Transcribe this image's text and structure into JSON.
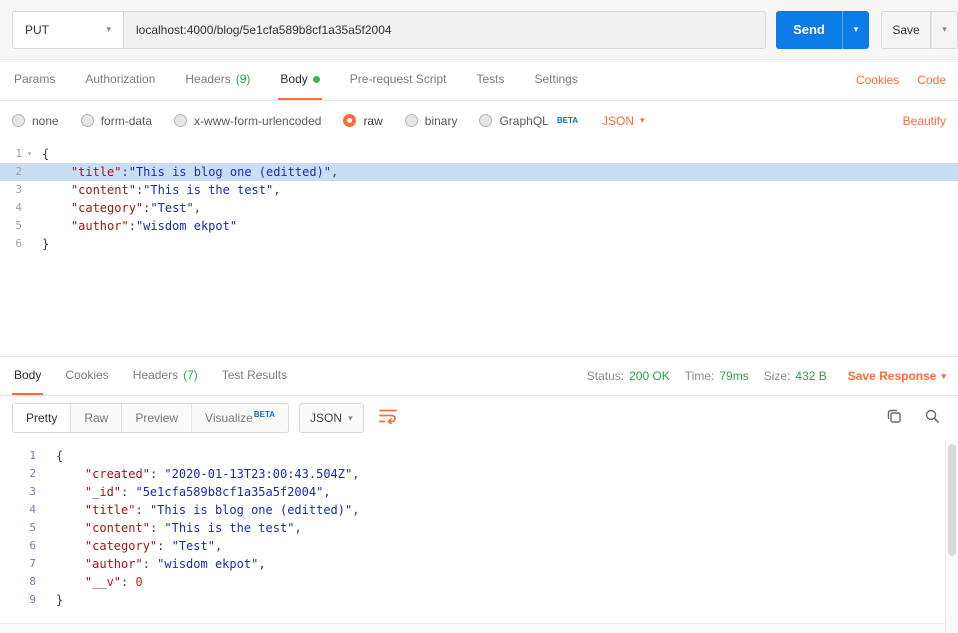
{
  "request": {
    "method": "PUT",
    "url": "localhost:4000/blog/5e1cfa589b8cf1a35a5f2004",
    "send_label": "Send",
    "save_label": "Save"
  },
  "request_tabs": {
    "items": [
      {
        "label": "Params",
        "count": ""
      },
      {
        "label": "Authorization",
        "count": ""
      },
      {
        "label": "Headers",
        "count": "(9)"
      },
      {
        "label": "Body",
        "count": ""
      },
      {
        "label": "Pre-request Script",
        "count": ""
      },
      {
        "label": "Tests",
        "count": ""
      },
      {
        "label": "Settings",
        "count": ""
      }
    ],
    "cookies_link": "Cookies",
    "code_link": "Code"
  },
  "body_options": {
    "items": [
      "none",
      "form-data",
      "x-www-form-urlencoded",
      "raw",
      "binary",
      "GraphQL"
    ],
    "beta_tag": "BETA",
    "language": "JSON",
    "beautify_link": "Beautify"
  },
  "request_editor": {
    "lines": [
      {
        "n": 1,
        "fold": true,
        "t": [
          [
            "{",
            "p"
          ]
        ]
      },
      {
        "n": 2,
        "hl": true,
        "t": [
          [
            "    ",
            "p"
          ],
          [
            "\"title\"",
            "k"
          ],
          [
            ":",
            "p"
          ],
          [
            "\"This is blog one (editted)\"",
            "s"
          ],
          [
            ",",
            "p"
          ]
        ]
      },
      {
        "n": 3,
        "t": [
          [
            "    ",
            "p"
          ],
          [
            "\"content\"",
            "k"
          ],
          [
            ":",
            "p"
          ],
          [
            "\"This is the test\"",
            "s"
          ],
          [
            ",",
            "p"
          ]
        ]
      },
      {
        "n": 4,
        "t": [
          [
            "    ",
            "p"
          ],
          [
            "\"category\"",
            "k"
          ],
          [
            ":",
            "p"
          ],
          [
            "\"Test\"",
            "s"
          ],
          [
            ",",
            "p"
          ]
        ]
      },
      {
        "n": 5,
        "t": [
          [
            "    ",
            "p"
          ],
          [
            "\"author\"",
            "k"
          ],
          [
            ":",
            "p"
          ],
          [
            "\"wisdom ekpot\"",
            "s"
          ]
        ]
      },
      {
        "n": 6,
        "t": [
          [
            "}",
            "p"
          ]
        ]
      }
    ]
  },
  "response_tabs": {
    "items": [
      {
        "label": "Body",
        "count": ""
      },
      {
        "label": "Cookies",
        "count": ""
      },
      {
        "label": "Headers",
        "count": "(7)"
      },
      {
        "label": "Test Results",
        "count": ""
      }
    ],
    "status_label": "Status:",
    "status_value": "200 OK",
    "time_label": "Time:",
    "time_value": "79ms",
    "size_label": "Size:",
    "size_value": "432 B",
    "save_response": "Save Response"
  },
  "response_toolbar": {
    "views": [
      "Pretty",
      "Raw",
      "Preview",
      "Visualize"
    ],
    "beta_tag": "BETA",
    "language": "JSON"
  },
  "response_editor": {
    "lines": [
      {
        "n": 1,
        "t": [
          [
            "{",
            "p"
          ]
        ]
      },
      {
        "n": 2,
        "t": [
          [
            "    ",
            "p"
          ],
          [
            "\"created\"",
            "k"
          ],
          [
            ": ",
            "p"
          ],
          [
            "\"2020-01-13T23:00:43.504Z\"",
            "s"
          ],
          [
            ",",
            "p"
          ]
        ]
      },
      {
        "n": 3,
        "t": [
          [
            "    ",
            "p"
          ],
          [
            "\"_id\"",
            "k"
          ],
          [
            ": ",
            "p"
          ],
          [
            "\"5e1cfa589b8cf1a35a5f2004\"",
            "s"
          ],
          [
            ",",
            "p"
          ]
        ]
      },
      {
        "n": 4,
        "t": [
          [
            "    ",
            "p"
          ],
          [
            "\"title\"",
            "k"
          ],
          [
            ": ",
            "p"
          ],
          [
            "\"This is blog one (editted)\"",
            "s"
          ],
          [
            ",",
            "p"
          ]
        ]
      },
      {
        "n": 5,
        "t": [
          [
            "    ",
            "p"
          ],
          [
            "\"content\"",
            "k"
          ],
          [
            ": ",
            "p"
          ],
          [
            "\"This is the test\"",
            "s"
          ],
          [
            ",",
            "p"
          ]
        ]
      },
      {
        "n": 6,
        "t": [
          [
            "    ",
            "p"
          ],
          [
            "\"category\"",
            "k"
          ],
          [
            ": ",
            "p"
          ],
          [
            "\"Test\"",
            "s"
          ],
          [
            ",",
            "p"
          ]
        ]
      },
      {
        "n": 7,
        "t": [
          [
            "    ",
            "p"
          ],
          [
            "\"author\"",
            "k"
          ],
          [
            ": ",
            "p"
          ],
          [
            "\"wisdom ekpot\"",
            "s"
          ],
          [
            ",",
            "p"
          ]
        ]
      },
      {
        "n": 8,
        "t": [
          [
            "    ",
            "p"
          ],
          [
            "\"__v\"",
            "k"
          ],
          [
            ": ",
            "p"
          ],
          [
            "0",
            "n"
          ]
        ]
      },
      {
        "n": 9,
        "t": [
          [
            "}",
            "p"
          ]
        ]
      }
    ]
  },
  "colors": {
    "accent_orange": "#ff6c37",
    "send_blue": "#0a7ce8",
    "status_green": "#2ca24c",
    "beta_blue": "#0678bc",
    "line_highlight": "#c9def5"
  }
}
